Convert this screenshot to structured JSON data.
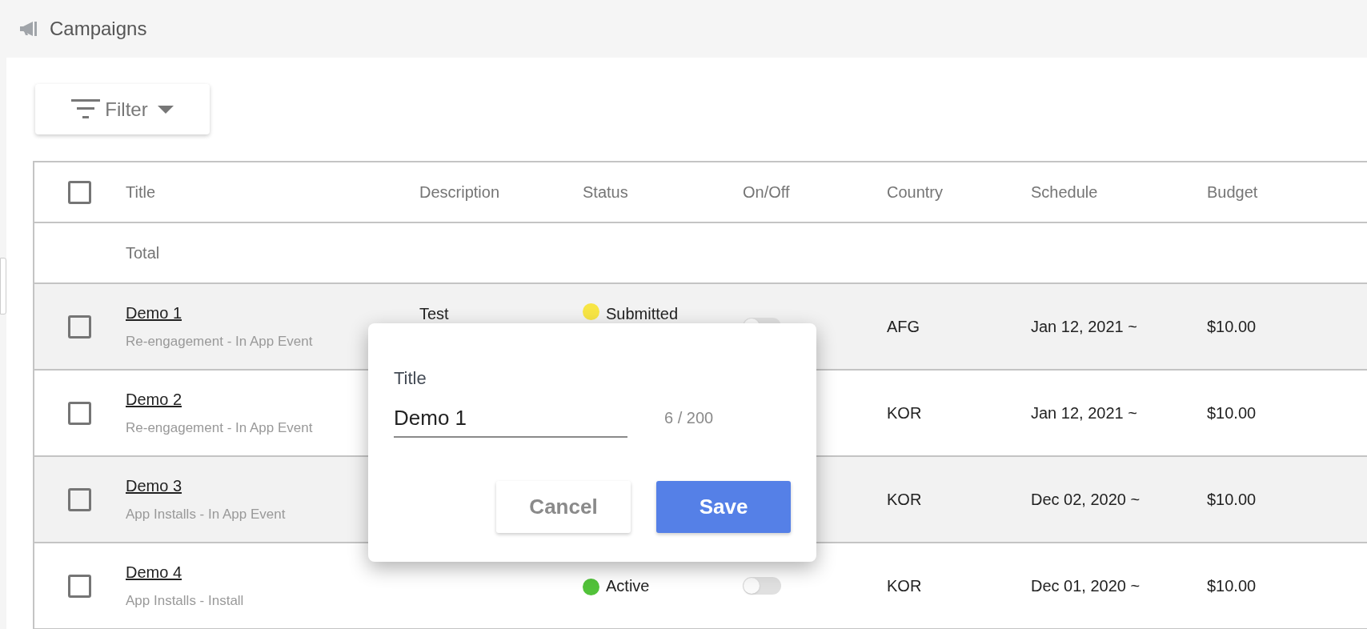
{
  "page": {
    "title": "Campaigns"
  },
  "filter_button": {
    "label": "Filter"
  },
  "table": {
    "header_checkbox": {
      "checked": false
    },
    "columns": [
      "Title",
      "Description",
      "Status",
      "On/Off",
      "Country",
      "Schedule",
      "Budget"
    ],
    "total_label": "Total",
    "rows": [
      {
        "checked": false,
        "title": "Demo 1",
        "subtitle": "Re-engagement - In App Event",
        "description": "Test",
        "status": {
          "label": "Submitted",
          "color": "#f7e545"
        },
        "on": false,
        "country": "AFG",
        "schedule": "Jan 12, 2021 ~",
        "budget": "$10.00"
      },
      {
        "checked": false,
        "title": "Demo 2",
        "subtitle": "Re-engagement - In App Event",
        "country": "KOR",
        "schedule": "Jan 12, 2021 ~",
        "budget": "$10.00"
      },
      {
        "checked": false,
        "title": "Demo 3",
        "subtitle": "App Installs - In App Event",
        "country": "KOR",
        "schedule": "Dec 02, 2020 ~",
        "budget": "$10.00"
      },
      {
        "checked": false,
        "title": "Demo 4",
        "subtitle": "App Installs - Install",
        "status": {
          "label": "Active",
          "color": "#52c23a"
        },
        "on": false,
        "country": "KOR",
        "schedule": "Dec 01, 2020 ~",
        "budget": "$10.00"
      }
    ]
  },
  "dialog": {
    "label": "Title",
    "value": "Demo 1",
    "counter": "6 / 200",
    "buttons": [
      {
        "kind": "secondary",
        "label": "Cancel"
      },
      {
        "kind": "primary",
        "label": "Save"
      }
    ]
  }
}
